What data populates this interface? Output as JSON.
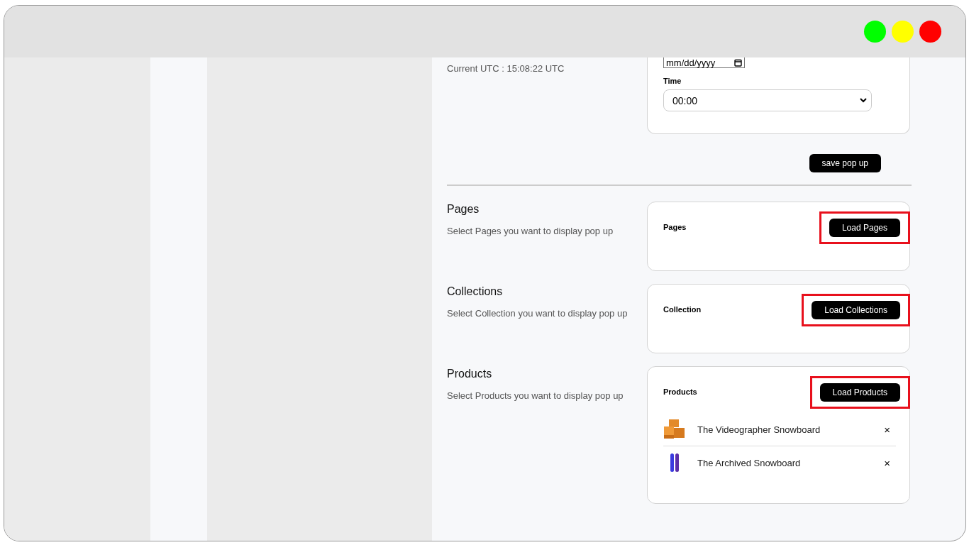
{
  "window_controls": [
    {
      "color": "#00ff00"
    },
    {
      "color": "#ffff00"
    },
    {
      "color": "#ff0000"
    }
  ],
  "schedule": {
    "current_utc": "Current UTC : 15:08:22 UTC",
    "date_field": {
      "placeholder": "mm/dd/yyyy"
    },
    "time_label": "Time",
    "time_select": {
      "value": "00:00"
    },
    "save_button": "save pop up"
  },
  "sections": [
    {
      "heading": "Pages",
      "description": "Select Pages you want to display pop up",
      "card_label": "Pages",
      "button": "Load Pages",
      "highlighted": true
    },
    {
      "heading": "Collections",
      "description": "Select Collection you want to display pop up",
      "card_label": "Collection",
      "button": "Load Collections",
      "highlighted": true
    },
    {
      "heading": "Products",
      "description": "Select Products you want to display pop up",
      "card_label": "Products",
      "button": "Load Products",
      "highlighted": true,
      "items": [
        {
          "kind": "boxes",
          "name": "The Videographer Snowboard",
          "remove": "×"
        },
        {
          "kind": "snowboard",
          "name": "The Archived Snowboard",
          "remove": "×"
        }
      ]
    }
  ]
}
